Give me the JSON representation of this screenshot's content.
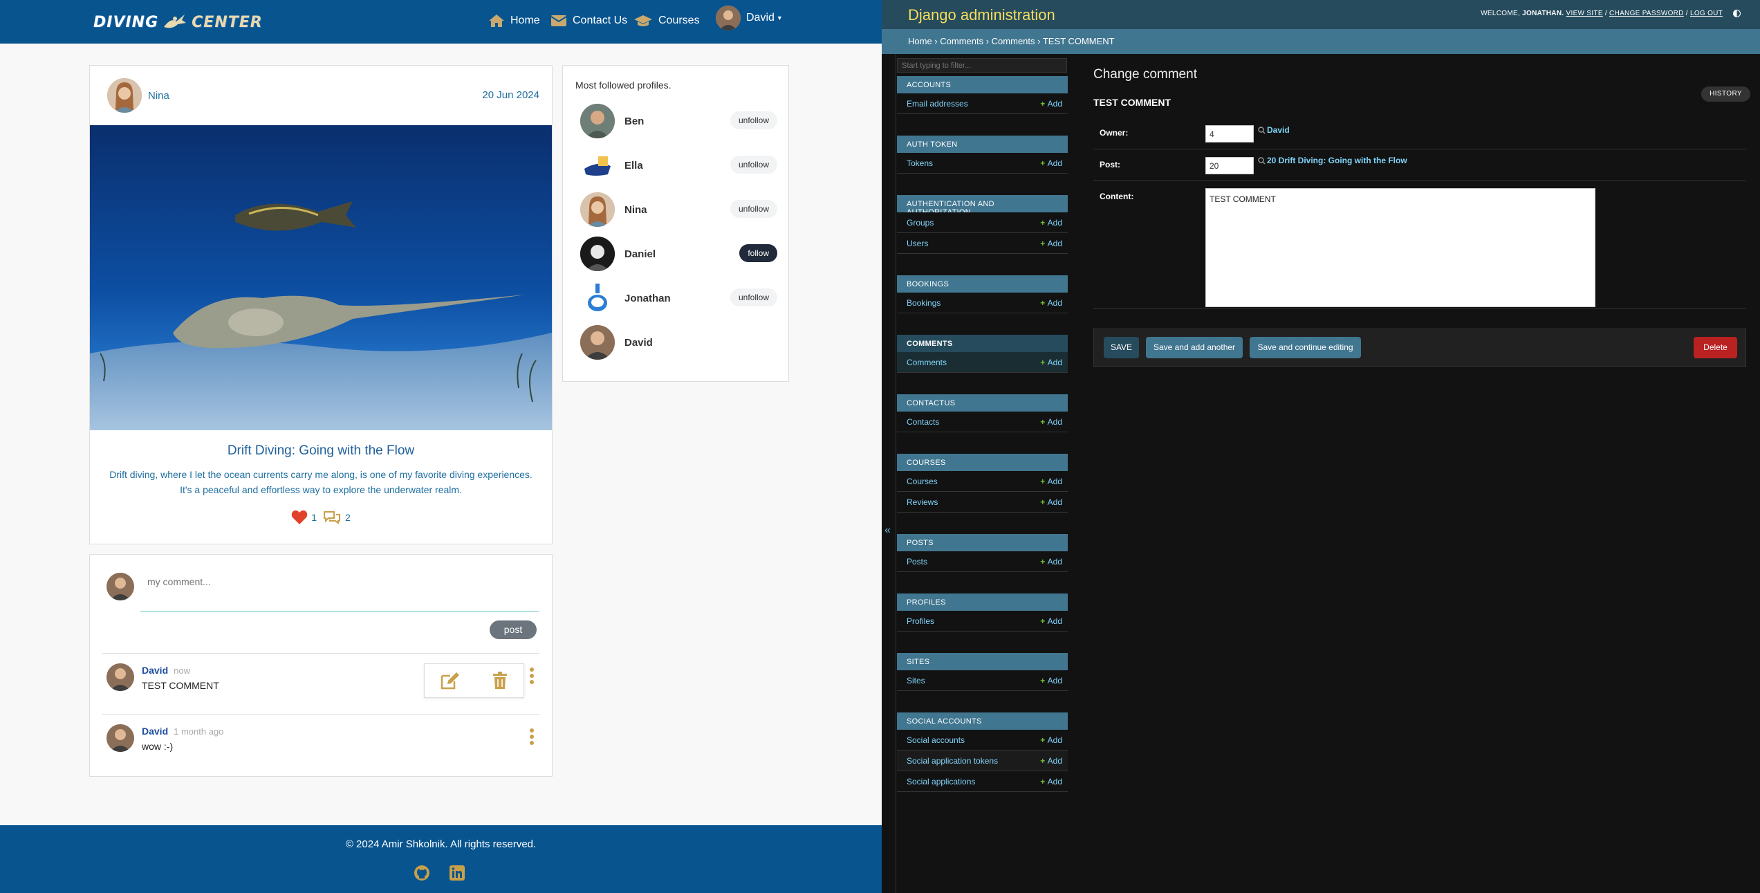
{
  "site": {
    "logo_text_1": "DIVING",
    "logo_text_2": "CENTER",
    "nav": {
      "home": "Home",
      "contact": "Contact Us",
      "courses": "Courses",
      "user": "David"
    }
  },
  "post": {
    "author": "Nina",
    "date": "20 Jun 2024",
    "title": "Drift Diving: Going with the Flow",
    "body_line1": "Drift diving, where I let the ocean currents carry me along, is one of my favorite diving experiences.",
    "body_line2": "It's a peaceful and effortless way to explore the underwater realm.",
    "likes": "1",
    "comments": "2"
  },
  "comment_form": {
    "placeholder": "my comment...",
    "submit": "post"
  },
  "comments": [
    {
      "author": "David",
      "time": "now",
      "text": "TEST COMMENT"
    },
    {
      "author": "David",
      "time": "1 month ago",
      "text": "wow :-)"
    }
  ],
  "profiles": {
    "title": "Most followed profiles.",
    "items": [
      {
        "name": "Ben",
        "button": "unfollow"
      },
      {
        "name": "Ella",
        "button": "unfollow"
      },
      {
        "name": "Nina",
        "button": "unfollow"
      },
      {
        "name": "Daniel",
        "button": "follow"
      },
      {
        "name": "Jonathan",
        "button": "unfollow"
      },
      {
        "name": "David",
        "button": ""
      }
    ]
  },
  "footer": {
    "text": "© 2024 Amir Shkolnik. All rights reserved."
  },
  "admin": {
    "branding": "Django administration",
    "user_tools": {
      "welcome": "WELCOME,",
      "user": "JONATHAN.",
      "view_site": "VIEW SITE",
      "change_password": "CHANGE PASSWORD",
      "logout": "LOG OUT"
    },
    "breadcrumbs": [
      "Home",
      "Comments",
      "Comments",
      "TEST COMMENT"
    ],
    "filter_placeholder": "Start typing to filter...",
    "toggle_nav": "«",
    "add_label": "Add",
    "modules": [
      {
        "caption": "Accounts",
        "rows": [
          "Email addresses"
        ]
      },
      {
        "caption": "Auth Token",
        "rows": [
          "Tokens"
        ]
      },
      {
        "caption": "Authentication and Authorization",
        "rows": [
          "Groups",
          "Users"
        ]
      },
      {
        "caption": "Bookings",
        "rows": [
          "Bookings"
        ]
      },
      {
        "caption": "Comments",
        "rows": [
          "Comments"
        ]
      },
      {
        "caption": "Contactus",
        "rows": [
          "Contacts"
        ]
      },
      {
        "caption": "Courses",
        "rows": [
          "Courses",
          "Reviews"
        ]
      },
      {
        "caption": "Posts",
        "rows": [
          "Posts"
        ]
      },
      {
        "caption": "Profiles",
        "rows": [
          "Profiles"
        ]
      },
      {
        "caption": "Sites",
        "rows": [
          "Sites"
        ]
      },
      {
        "caption": "Social Accounts",
        "rows": [
          "Social accounts",
          "Social application tokens",
          "Social applications"
        ]
      }
    ],
    "content": {
      "title": "Change comment",
      "history": "HISTORY",
      "object": "TEST COMMENT",
      "fields": {
        "owner_label": "Owner:",
        "owner_value": "4",
        "owner_link": "David",
        "post_label": "Post:",
        "post_value": "20",
        "post_link": "20 Drift Diving: Going with the Flow",
        "content_label": "Content:",
        "content_value": "TEST COMMENT"
      },
      "buttons": {
        "save": "SAVE",
        "save_add": "Save and add another",
        "save_continue": "Save and continue editing",
        "delete": "Delete"
      }
    }
  },
  "colors": {
    "site_nav": "#08548f",
    "admin_header": "#264b5d",
    "admin_module": "#417690",
    "admin_link": "#81d4fa",
    "accent_gold": "#c9a04a",
    "delete": "#ba2121"
  }
}
